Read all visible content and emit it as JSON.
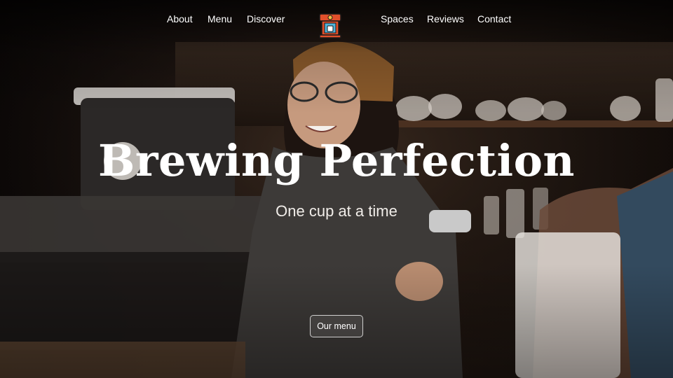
{
  "nav": {
    "left_links": [
      {
        "label": "About"
      },
      {
        "label": "Menu"
      },
      {
        "label": "Discover"
      }
    ],
    "right_links": [
      {
        "label": "Spaces"
      },
      {
        "label": "Reviews"
      },
      {
        "label": "Contact"
      }
    ],
    "logo_icon": "espresso-machine-icon"
  },
  "hero": {
    "headline": "Brewing Perfection",
    "subheadline": "One cup at a time",
    "cta_label": "Our menu",
    "background_image": "barista-smiling-behind-counter",
    "accent_color": "#e2502b"
  }
}
